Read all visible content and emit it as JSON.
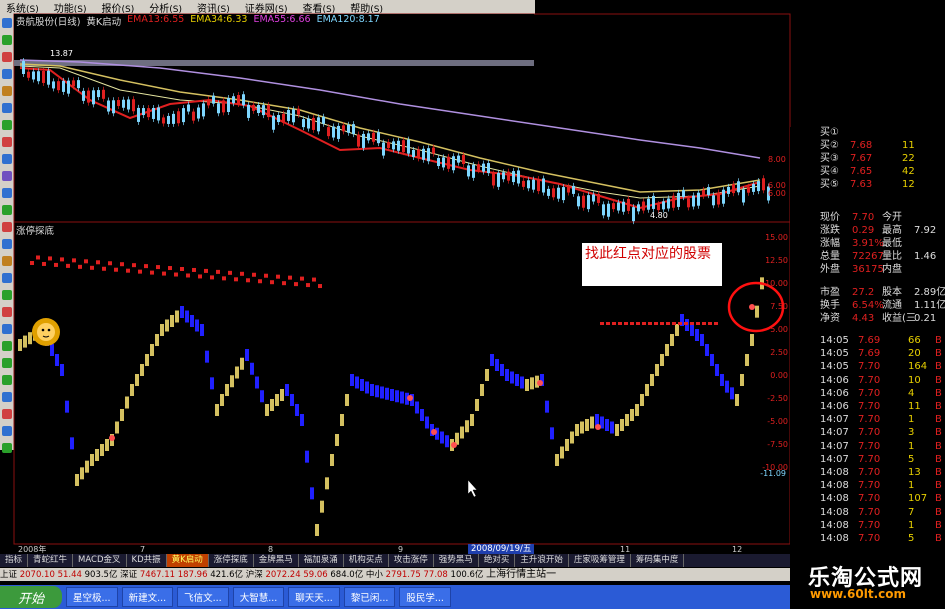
{
  "menubar": [
    "系统",
    "功能",
    "报价",
    "分析",
    "资讯",
    "证券网",
    "查看",
    "帮助"
  ],
  "chart_header": {
    "name": "贵航股份(日线)",
    "indicator": "黄K启动",
    "ema13": "EMA13:6.55",
    "ema34": "EMA34:6.33",
    "ema55": "EMA55:6.66",
    "ema120": "EMA120:8.17",
    "high_mark": "13.87",
    "low_mark": "4.80"
  },
  "sub_title": "涨停探底",
  "price_axis": [
    "8.00",
    "6.00",
    "6.00"
  ],
  "sub_axis": [
    "15.00",
    "12.50",
    "10.00",
    "7.50",
    "5.00",
    "2.50",
    "0.00",
    "-2.50",
    "-5.00",
    "-7.50",
    "-10.00",
    "-11.09"
  ],
  "annotation": "找此红点对应的股票",
  "right_panel": {
    "bids": [
      {
        "label": "买①",
        "price": "",
        "vol": ""
      },
      {
        "label": "买②",
        "price": "7.68",
        "vol": "11"
      },
      {
        "label": "买③",
        "price": "7.67",
        "vol": "22"
      },
      {
        "label": "买④",
        "price": "7.65",
        "vol": "42"
      },
      {
        "label": "买⑤",
        "price": "7.63",
        "vol": "12"
      }
    ],
    "stats": [
      {
        "a": "现价",
        "b": "7.70",
        "c": "今开",
        "d": ""
      },
      {
        "a": "涨跌",
        "b": "0.29",
        "c": "最高",
        "d": "7.92"
      },
      {
        "a": "涨幅",
        "b": "3.91%",
        "c": "最低",
        "d": ""
      },
      {
        "a": "总量",
        "b": "72267",
        "c": "量比",
        "d": "1.46"
      },
      {
        "a": "外盘",
        "b": "36175",
        "c": "内盘",
        "d": ""
      },
      {
        "a": "市盈",
        "b": "27.2",
        "c": "股本",
        "d": "2.89亿"
      },
      {
        "a": "换手",
        "b": "6.54%",
        "c": "流通",
        "d": "1.11亿"
      },
      {
        "a": "净资",
        "b": "4.43",
        "c": "收益(三",
        "d": "0.21"
      }
    ],
    "ticks": [
      {
        "t": "14:05",
        "p": "7.69",
        "v": "66",
        "s": "B"
      },
      {
        "t": "14:05",
        "p": "7.69",
        "v": "20",
        "s": "B"
      },
      {
        "t": "14:05",
        "p": "7.70",
        "v": "164",
        "s": "B"
      },
      {
        "t": "14:06",
        "p": "7.70",
        "v": "10",
        "s": "B"
      },
      {
        "t": "14:06",
        "p": "7.70",
        "v": "4",
        "s": "B"
      },
      {
        "t": "14:06",
        "p": "7.70",
        "v": "11",
        "s": "B"
      },
      {
        "t": "14:07",
        "p": "7.70",
        "v": "1",
        "s": "B"
      },
      {
        "t": "14:07",
        "p": "7.70",
        "v": "3",
        "s": "B"
      },
      {
        "t": "14:07",
        "p": "7.70",
        "v": "1",
        "s": "B"
      },
      {
        "t": "14:07",
        "p": "7.70",
        "v": "5",
        "s": "B"
      },
      {
        "t": "14:08",
        "p": "7.70",
        "v": "13",
        "s": "B"
      },
      {
        "t": "14:08",
        "p": "7.70",
        "v": "1",
        "s": "B"
      },
      {
        "t": "14:08",
        "p": "7.70",
        "v": "107",
        "s": "B"
      },
      {
        "t": "14:08",
        "p": "7.70",
        "v": "7",
        "s": "B"
      },
      {
        "t": "14:08",
        "p": "7.70",
        "v": "1",
        "s": "B"
      },
      {
        "t": "14:08",
        "p": "7.70",
        "v": "5",
        "s": "B"
      }
    ]
  },
  "date_axis": [
    "2008年",
    "7",
    "8",
    "9",
    "10",
    "11",
    "12"
  ],
  "date_info": "2008/09/19/五",
  "tabs": [
    "指标",
    "青蛇红牛",
    "MACD金叉",
    "KD共振",
    "黄K启动",
    "涨停探底",
    "金牌黑马",
    "福加泉涌",
    "机构买点",
    "攻击涨停",
    "强势黑马",
    "绝对买",
    "主升浪开始",
    "庄家吸筹管理",
    "筹码集中度"
  ],
  "active_tab": "黄K启动",
  "status": {
    "sh_label": "上证",
    "sh_value": "2070.10",
    "sh_chg": "51.44",
    "sh_vol": "903.5亿",
    "sz_label": "深证",
    "sz_value": "7467.11",
    "sz_chg": "187.96",
    "sz_vol": "421.6亿",
    "hs_label": "沪深",
    "hs_value": "2072.24",
    "hs_chg": "59.06",
    "hs_vol": "684.0亿",
    "zx_label": "中小",
    "zx_value": "2791.75",
    "zx_chg": "77.08",
    "zx_vol": "100.6亿",
    "ticker": "上海行情主站一"
  },
  "taskbar": {
    "start": "开始",
    "tasks": [
      "星空极...",
      "新建文...",
      "飞信文...",
      "大智慧...",
      "聊天天...",
      "黎已闲...",
      "股民学..."
    ]
  },
  "watermark": {
    "line1": "乐淘公式网",
    "line2": "www.60lt.com"
  },
  "colors": {
    "red": "#e02020",
    "yellow": "#e8d000",
    "cyan": "#7fd7ff",
    "blue": "#2020ff",
    "gold": "#d4c060",
    "purple": "#b090e0"
  }
}
